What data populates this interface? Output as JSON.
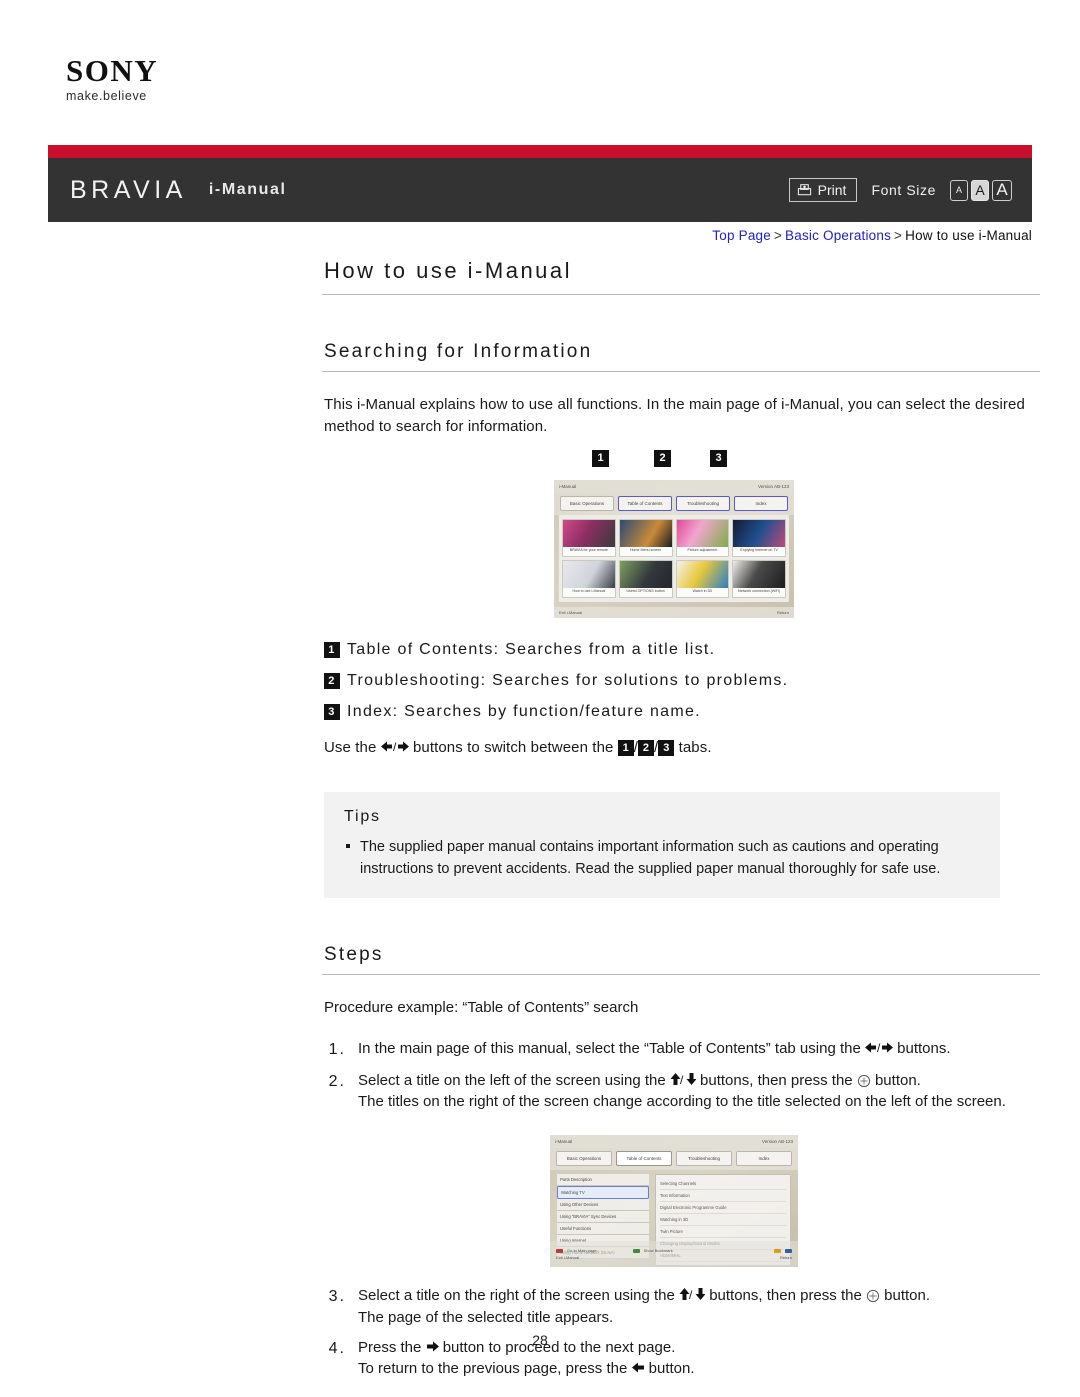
{
  "brand": {
    "logo_text": "SONY",
    "tagline": "make.believe"
  },
  "header": {
    "product": "BRAVIA",
    "manual_label": "i-Manual",
    "print_label": "Print",
    "font_size_label": "Font Size",
    "font_size_options": [
      "A",
      "A",
      "A"
    ],
    "font_size_selected_index": 1,
    "stripe_color": "#c8102e",
    "bar_color": "#333333"
  },
  "breadcrumb": {
    "items": [
      {
        "label": "Top Page",
        "is_link": true
      },
      {
        "label": "Basic Operations",
        "is_link": true
      },
      {
        "label": "How to use i-Manual",
        "is_link": false
      }
    ],
    "separator": ">",
    "link_color": "#2020cc"
  },
  "page": {
    "title": "How to use i-Manual",
    "page_number": "28"
  },
  "section_search": {
    "heading": "Searching for Information",
    "intro": "This i-Manual explains how to use all functions. In the main page of i-Manual, you can select the desired method to search for information.",
    "features": [
      {
        "badge": "1",
        "text": "Table of Contents: Searches from a title list."
      },
      {
        "badge": "2",
        "text": "Troubleshooting: Searches for solutions to problems."
      },
      {
        "badge": "3",
        "text": "Index: Searches by function/feature name."
      }
    ],
    "use_line_prefix": "Use the ",
    "use_line_mid": " buttons to switch between the ",
    "use_line_suffix": " tabs."
  },
  "tips": {
    "title": "Tips",
    "items": [
      "The supplied paper manual contains important information such as cautions and operating instructions to prevent accidents. Read the supplied paper manual thoroughly for safe use."
    ]
  },
  "section_steps": {
    "heading": "Steps",
    "intro": "Procedure example: “Table of Contents” search",
    "steps": [
      {
        "number": "1.",
        "line1_a": "In the main page of this manual, select the “Table of Contents” tab using the ",
        "line1_b": " buttons.",
        "line2": ""
      },
      {
        "number": "2.",
        "line1_a": "Select a title on the left of the screen using the ",
        "line1_b": " buttons, then press the ",
        "line1_c": " button.",
        "line2": "The titles on the right of the screen change according to the title selected on the left of the screen."
      },
      {
        "number": "3.",
        "line1_a": "Select a title on the right of the screen using the ",
        "line1_b": " buttons, then press the ",
        "line1_c": " button.",
        "line2": "The page of the selected title appears."
      },
      {
        "number": "4.",
        "line1_a": "Press the ",
        "line1_b": " button to proceed to the next page.",
        "line2_a": "To return to the previous page, press the ",
        "line2_b": " button."
      }
    ]
  },
  "mock_main_page": {
    "callouts": [
      "1",
      "2",
      "3"
    ],
    "title_bar": {
      "left": "i-Manual",
      "right": "Version  AB-123"
    },
    "category_tab": "Basic Operations",
    "tabs": [
      "Table of Contents",
      "Troubleshooting",
      "Index"
    ],
    "thumbnails": [
      {
        "caption": "BRAVIA for your remote"
      },
      {
        "caption": "Home Menu screen"
      },
      {
        "caption": "Picture adjustment"
      },
      {
        "caption": "Enjoying Internet on TV"
      },
      {
        "caption": "How to use i-Manual"
      },
      {
        "caption": "Useful OPTIONS button"
      },
      {
        "caption": "Watch in 3D"
      },
      {
        "caption": "Network connection (WiFi)"
      }
    ],
    "footer_left": "Exit i-Manual",
    "footer_right": "Return"
  },
  "mock_toc_page": {
    "title_bar": {
      "left": "i-Manual",
      "right": "Version  AB-123"
    },
    "tabs": [
      "Basic Operations",
      "Table of Contents",
      "Troubleshooting",
      "Index"
    ],
    "selected_tab_index": 1,
    "left_items": [
      "Parts Description",
      "Watching TV",
      "Using Other Devices",
      "Using “BRAVIA” Sync Devices",
      "Useful Functions",
      "Using Internet",
      "Using Home Network (DLNA)"
    ],
    "selected_left_index": 1,
    "right_items": [
      "Selecting Channels",
      "Text Information",
      "Digital Electronic Programme Guide",
      "Watching in 3D",
      "Twin Picture",
      "Changing Display/Sound Modes",
      "HDMI/MHL"
    ],
    "footer_left": "Go to Main page",
    "footer_mid": "Show Bookmark",
    "footer_exit": "Exit i-Manual",
    "footer_return": "Return"
  }
}
